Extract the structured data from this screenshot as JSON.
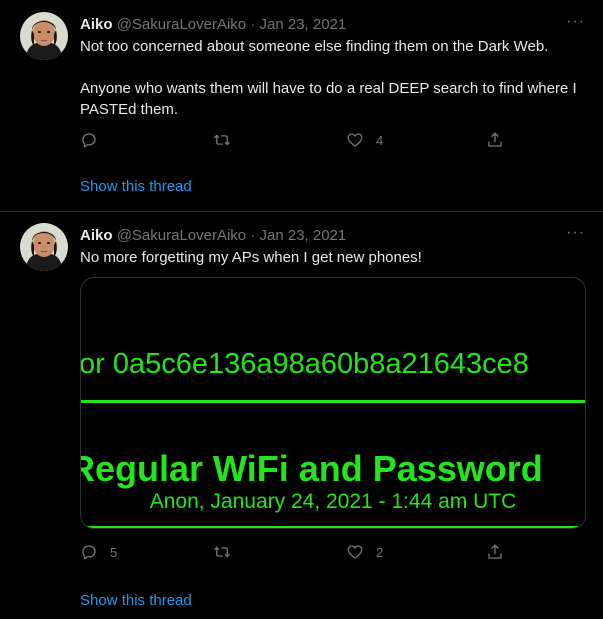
{
  "tweets": [
    {
      "author": {
        "name": "Aiko",
        "handle": "@SakuraLoverAiko",
        "separator": "·",
        "date": "Jan 23, 2021"
      },
      "more_label": "···",
      "paragraphs": [
        "Not too concerned about someone else finding them on the Dark Web.",
        "Anyone who wants them will have to do a real DEEP search to find where I PASTEd them."
      ],
      "actions": {
        "reply_count": "",
        "retweet_count": "",
        "like_count": "4"
      },
      "show_thread": "Show this thread"
    },
    {
      "author": {
        "name": "Aiko",
        "handle": "@SakuraLoverAiko",
        "separator": "·",
        "date": "Jan 23, 2021"
      },
      "more_label": "···",
      "paragraphs": [
        "No more forgetting my APs when I get new phones!"
      ],
      "media": {
        "hash_text": "or 0a5c6e136a98a60b8a21643ce8",
        "title": "Regular WiFi and Password",
        "byline": "Anon, January 24, 2021 - 1:44 am UTC"
      },
      "actions": {
        "reply_count": "5",
        "retweet_count": "",
        "like_count": "2"
      },
      "show_thread": "Show this thread"
    }
  ],
  "colors": {
    "background": "#000000",
    "text": "#e7e9ea",
    "secondary": "#71767b",
    "link": "#1d9bf0",
    "divider": "#2f3336",
    "terminal_green": "#22e51b"
  },
  "icons": {
    "reply": "reply-icon",
    "retweet": "retweet-icon",
    "like": "heart-icon",
    "share": "share-icon",
    "more": "more-icon"
  }
}
